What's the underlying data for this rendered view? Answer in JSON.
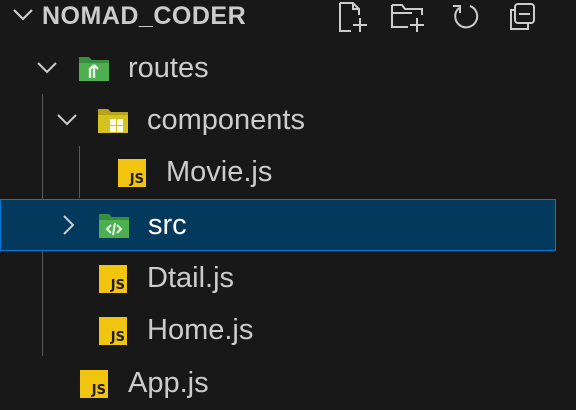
{
  "explorer": {
    "title": "NOMAD_CODER",
    "actions": {
      "new_file": "new-file",
      "new_folder": "new-folder",
      "refresh": "refresh",
      "collapse_all": "collapse-all"
    },
    "tree": [
      {
        "label": "routes",
        "type": "folder",
        "icon": "folder-routes-icon",
        "expanded": true
      },
      {
        "label": "components",
        "type": "folder",
        "icon": "folder-components-icon",
        "expanded": true
      },
      {
        "label": "Movie.js",
        "type": "file",
        "icon": "js-file-icon"
      },
      {
        "label": "src",
        "type": "folder",
        "icon": "folder-src-icon",
        "expanded": false,
        "selected": true
      },
      {
        "label": "Dtail.js",
        "type": "file",
        "icon": "js-file-icon"
      },
      {
        "label": "Home.js",
        "type": "file",
        "icon": "js-file-icon"
      },
      {
        "label": "App.js",
        "type": "file",
        "icon": "js-file-icon"
      }
    ],
    "js_icon_text": "JS"
  },
  "colors": {
    "background": "#181818",
    "selected_bg": "#04395e",
    "selected_border": "#0078d4",
    "text": "#cccccc",
    "js_badge": "#f1c40f",
    "folder_green": "#4caf50"
  }
}
